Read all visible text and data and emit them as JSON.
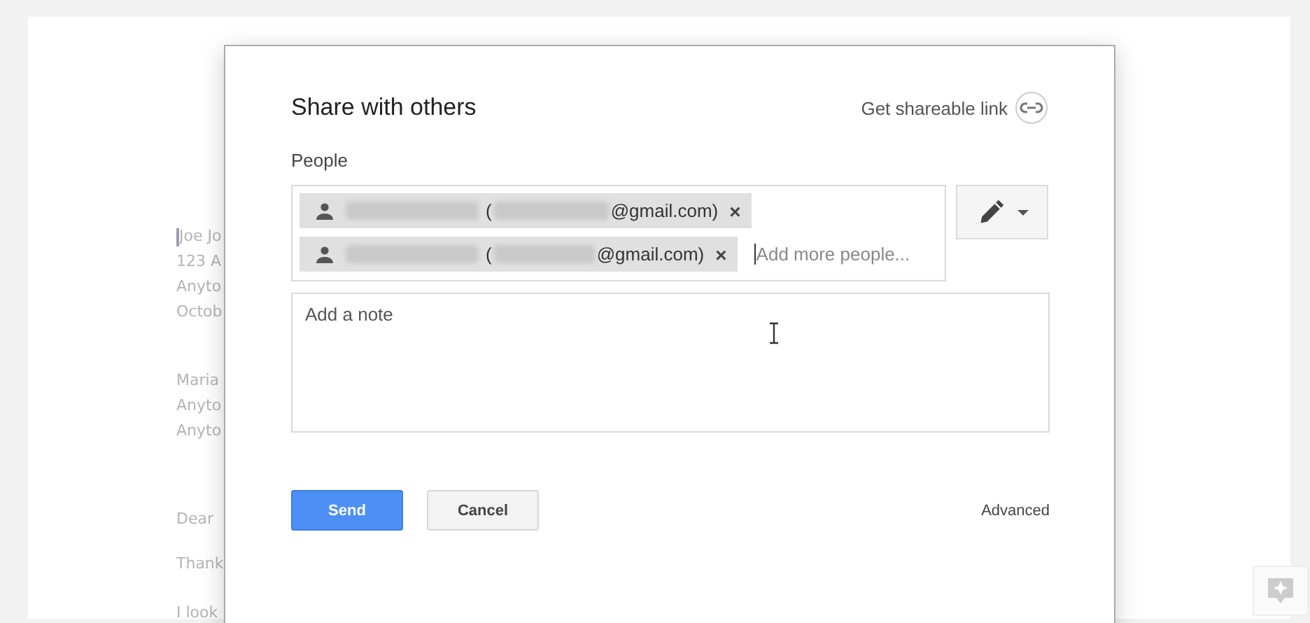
{
  "document": {
    "paragraphs": [
      {
        "lines": [
          {
            "text": "Joe Jo",
            "caret": true
          },
          {
            "text": "123 A",
            "caret": false
          },
          {
            "text": "Anyto",
            "caret": false
          },
          {
            "text": "Octob",
            "caret": false
          }
        ]
      },
      {
        "lines": [
          {
            "text": "Maria",
            "caret": false
          },
          {
            "text": "Anyto",
            "caret": false
          },
          {
            "text": "Anyto",
            "caret": false
          }
        ]
      },
      {
        "lines": [
          {
            "text": "Dear",
            "caret": false
          }
        ]
      },
      {
        "lines": [
          {
            "text": "Thank",
            "caret": false
          }
        ]
      },
      {
        "lines": [
          {
            "text": "I look",
            "caret": false
          }
        ]
      }
    ]
  },
  "dialog": {
    "title": "Share with others",
    "shareable_link": "Get shareable link",
    "people_label": "People",
    "recipients": [
      {
        "open": "(",
        "email_suffix": "@gmail.com)",
        "remove": "×"
      },
      {
        "open": "(",
        "email_suffix": "@gmail.com)",
        "remove": "×"
      }
    ],
    "add_people": {
      "placeholder": "Add more people..."
    },
    "note": {
      "placeholder": "Add a note"
    },
    "buttons": [
      {
        "label": "Send",
        "kind": "primary"
      },
      {
        "label": "Cancel",
        "kind": "secondary"
      }
    ],
    "advanced": "Advanced"
  }
}
